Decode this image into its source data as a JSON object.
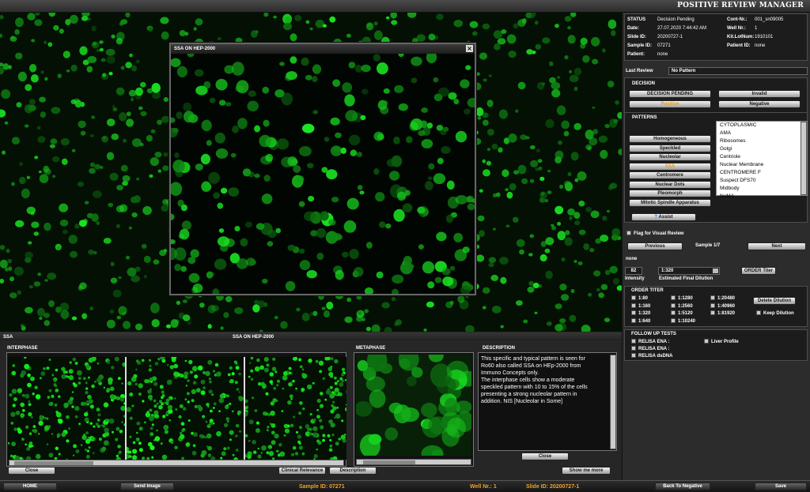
{
  "title": "POSITIVE REVIEW MANAGER",
  "popup": {
    "title": "SSA ON HEP-2000",
    "close": "×"
  },
  "strip": {
    "left": "SSA",
    "center": "SSA ON HEP-2000"
  },
  "interphase": {
    "label": "INTERPHASE",
    "close": "Close",
    "clinical": "Clinical Relevance",
    "description": "Description"
  },
  "metaphase": {
    "label": "METAPHASE"
  },
  "description": {
    "label": "DESCRIPTION",
    "lines": [
      "This specific and typical pattern is seen for",
      "Ro60 also called SSA on HEp-2000 from",
      "Immuno Concepts only.",
      "The interphase cells show a moderate",
      "speckled pattern with 10 to 15% of the cells",
      "presenting a strong nucleolar pattern in",
      "addition. NIS [Nucleolar in Some]"
    ],
    "close": "Close",
    "show_more": "Show  me  more"
  },
  "status": {
    "status_label": "STATUS",
    "status_value": "Decision Pending",
    "date_label": "Date:",
    "date_value": "27.07.2020  7:44:42 AM",
    "slide_label": "Slide ID:",
    "slide_value": "20200727-1",
    "sample_label": "Sample ID:",
    "sample_value": "07271",
    "patient_label": "Patient:",
    "patient_value": "none",
    "cont_label": "Cont-Nr.:",
    "cont_value": "001_sn09005",
    "well_label": "Well Nr.:",
    "well_value": "1",
    "kit_label": "Kit.LotNum:",
    "kit_value": "1910101",
    "patientid_label": "Patient ID:",
    "patientid_value": "none"
  },
  "last_review": {
    "label": "Last Review",
    "value": "No Pattern"
  },
  "decision": {
    "label": "DECISION",
    "pending": "DECISION PENDING",
    "invalid": "Invalid",
    "positive": "Positive",
    "negative": "Negative"
  },
  "patterns": {
    "label": "PATTERNS",
    "buttons": [
      "Homogeneous",
      "Speckled",
      "Nucleolar",
      "SSA",
      "Centromere",
      "Nuclear Dots",
      "Pleomorph",
      "Mitotic Spindle Apparatus"
    ],
    "selected": "SSA",
    "list": [
      "CYTOPLASMIC",
      "AMA",
      "Ribosomes",
      "Golgi",
      "Centriole",
      "Nuclear Membrane",
      "CENTROMERE F",
      "Suspect DFS70",
      "Midbody",
      "NuMA"
    ],
    "assist": "Assist"
  },
  "flag": "Flag for Visual Review",
  "nav": {
    "previous": "Previous",
    "sample": "Sample 1/7",
    "next": "Next"
  },
  "none_label": "none",
  "intensity": {
    "value": "82",
    "label": "Intensity",
    "dilution_value": "1:320",
    "dilution_label": "Estimated Final Dilution",
    "order_titer": "ORDER Titer"
  },
  "order_titer": {
    "label": "ORDER TITER",
    "col1": [
      "1:80",
      "1:160",
      "1:320",
      "1:640"
    ],
    "col2": [
      "1:1280",
      "1:2560",
      "1:5120",
      "1:10240"
    ],
    "col3": [
      "1:20480",
      "1:40960",
      "1:81920"
    ],
    "delete": "Delete Dilution",
    "keep": "Keep Dilution"
  },
  "follow_up": {
    "label": "FOLLOW UP TESTS",
    "items": [
      "RELISA ENA :",
      "RELISA ENA :",
      "RELISA dsDNA"
    ],
    "liver": "Liver Profile"
  },
  "bottom": {
    "home": "HOME",
    "send": "Send Image",
    "sample": "Sample ID: 07271",
    "well": "Well Nr.: 1",
    "slide": "Slide ID: 20200727-1",
    "back": "Back To Negative",
    "save": "Save"
  },
  "colors": {
    "accent": "#f0a22a",
    "fluor": "#2fd02f"
  }
}
